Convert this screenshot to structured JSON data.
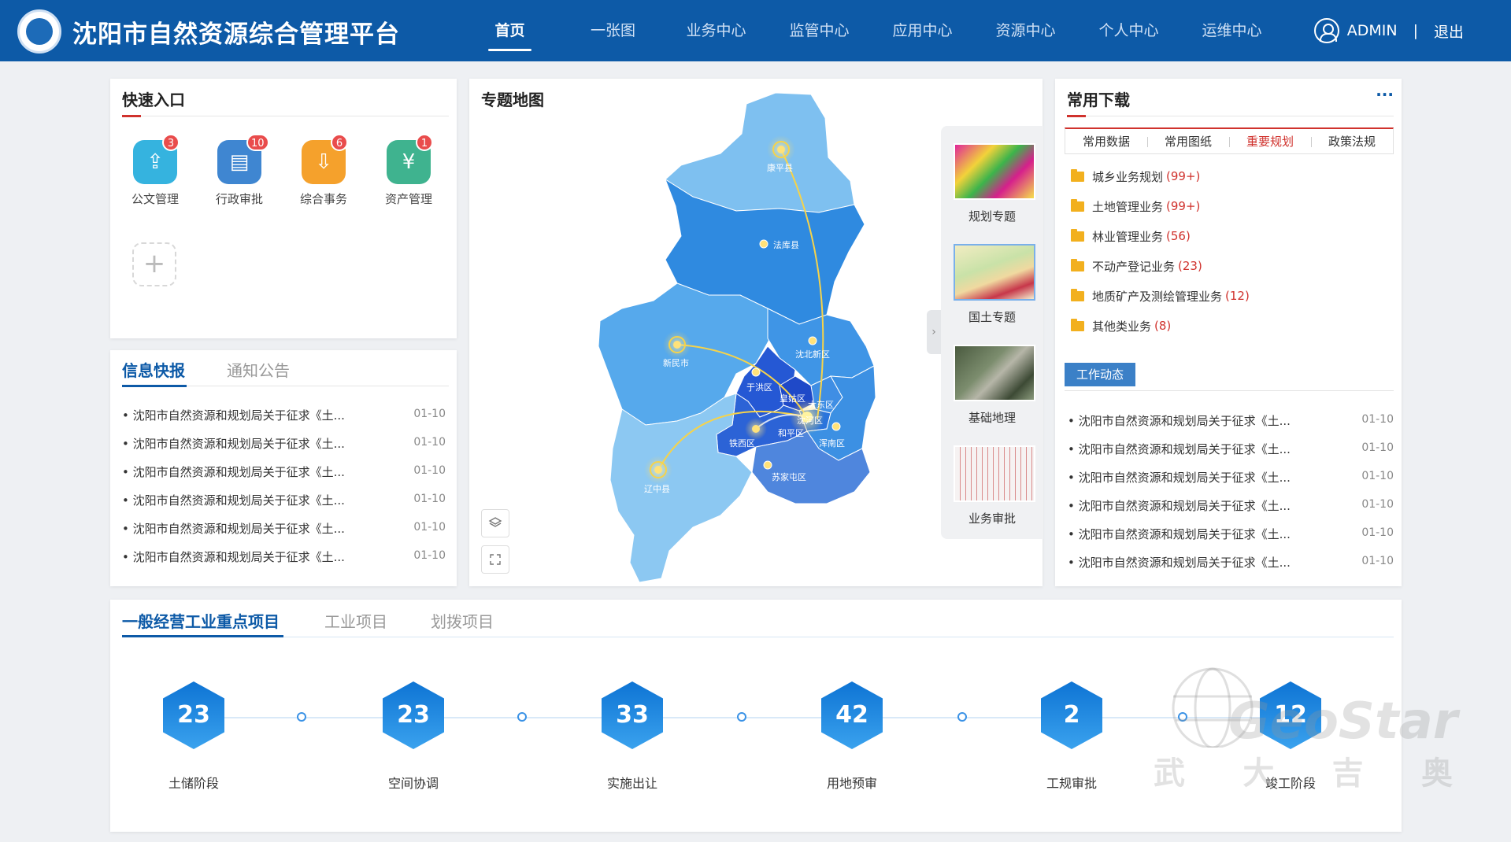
{
  "header": {
    "title": "沈阳市自然资源综合管理平台",
    "nav": [
      "首页",
      "一张图",
      "业务中心",
      "监管中心",
      "应用中心",
      "资源中心",
      "个人中心",
      "运维中心"
    ],
    "active_nav": "首页",
    "user": "ADMIN",
    "separator": "|",
    "logout": "退出"
  },
  "quick_entry": {
    "title": "快速入口",
    "items": [
      {
        "label": "公文管理",
        "badge": "3",
        "color": "#35b3df",
        "icon": "upload-doc-icon",
        "glyph": "⇪"
      },
      {
        "label": "行政审批",
        "badge": "10",
        "color": "#3f86d1",
        "icon": "open-book-icon",
        "glyph": "▤"
      },
      {
        "label": "综合事务",
        "badge": "6",
        "color": "#f5a12c",
        "icon": "download-doc-icon",
        "glyph": "⇩"
      },
      {
        "label": "资产管理",
        "badge": "1",
        "color": "#3fb38f",
        "icon": "yuan-coin-icon",
        "glyph": "¥"
      }
    ],
    "add": "+"
  },
  "info": {
    "tabs": [
      "信息快报",
      "通知公告"
    ],
    "items": [
      {
        "text": "• 沈阳市自然资源和规划局关于征求《土...",
        "date": "01-10"
      },
      {
        "text": "• 沈阳市自然资源和规划局关于征求《土...",
        "date": "01-10"
      },
      {
        "text": "• 沈阳市自然资源和规划局关于征求《土...",
        "date": "01-10"
      },
      {
        "text": "• 沈阳市自然资源和规划局关于征求《土...",
        "date": "01-10"
      },
      {
        "text": "• 沈阳市自然资源和规划局关于征求《土...",
        "date": "01-10"
      },
      {
        "text": "• 沈阳市自然资源和规划局关于征求《土...",
        "date": "01-10"
      }
    ]
  },
  "map": {
    "title": "专题地图",
    "labels": {
      "kangping": "康平县",
      "faku": "法库县",
      "xinmin": "新民市",
      "shenbei": "沈北新区",
      "yuhong": "于洪区",
      "huanggu": "皇姑区",
      "dadong": "大东区",
      "shenhe": "沈河区",
      "heping": "和平区",
      "tiexi": "铁西区",
      "hunnan": "浑南区",
      "sujiatun": "苏家屯区",
      "liaozhong": "辽中县"
    },
    "layers": [
      {
        "label": "规划专题"
      },
      {
        "label": "国土专题"
      },
      {
        "label": "基础地理"
      },
      {
        "label": "业务审批"
      }
    ],
    "active_layer": "国土专题",
    "collapse": "›"
  },
  "downloads": {
    "title": "常用下载",
    "more": "···",
    "tabs": [
      "常用数据",
      "常用图纸",
      "重要规划",
      "政策法规"
    ],
    "active_tab": "重要规划",
    "folders": [
      {
        "name": "城乡业务规划",
        "count": "(99+)"
      },
      {
        "name": "土地管理业务",
        "count": "(99+)"
      },
      {
        "name": "林业管理业务",
        "count": "(56)"
      },
      {
        "name": "不动产登记业务",
        "count": "(23)"
      },
      {
        "name": "地质矿产及测绘管理业务",
        "count": "(12)"
      },
      {
        "name": "其他类业务",
        "count": "(8)"
      }
    ],
    "work_title": "工作动态",
    "work_items": [
      {
        "text": "• 沈阳市自然资源和规划局关于征求《土...",
        "date": "01-10"
      },
      {
        "text": "• 沈阳市自然资源和规划局关于征求《土...",
        "date": "01-10"
      },
      {
        "text": "• 沈阳市自然资源和规划局关于征求《土...",
        "date": "01-10"
      },
      {
        "text": "• 沈阳市自然资源和规划局关于征求《土...",
        "date": "01-10"
      },
      {
        "text": "• 沈阳市自然资源和规划局关于征求《土...",
        "date": "01-10"
      },
      {
        "text": "• 沈阳市自然资源和规划局关于征求《土...",
        "date": "01-10"
      }
    ]
  },
  "projects": {
    "tabs": [
      "一般经营工业重点项目",
      "工业项目",
      "划拨项目"
    ],
    "stages": [
      {
        "value": "23",
        "label": "土储阶段"
      },
      {
        "value": "23",
        "label": "空间协调"
      },
      {
        "value": "33",
        "label": "实施出让"
      },
      {
        "value": "42",
        "label": "用地预审"
      },
      {
        "value": "2",
        "label": "工规审批"
      },
      {
        "value": "12",
        "label": "竣工阶段"
      }
    ]
  },
  "watermark": {
    "brand": "GeoStar",
    "chars": [
      "武",
      "大",
      "吉",
      "奥"
    ]
  }
}
